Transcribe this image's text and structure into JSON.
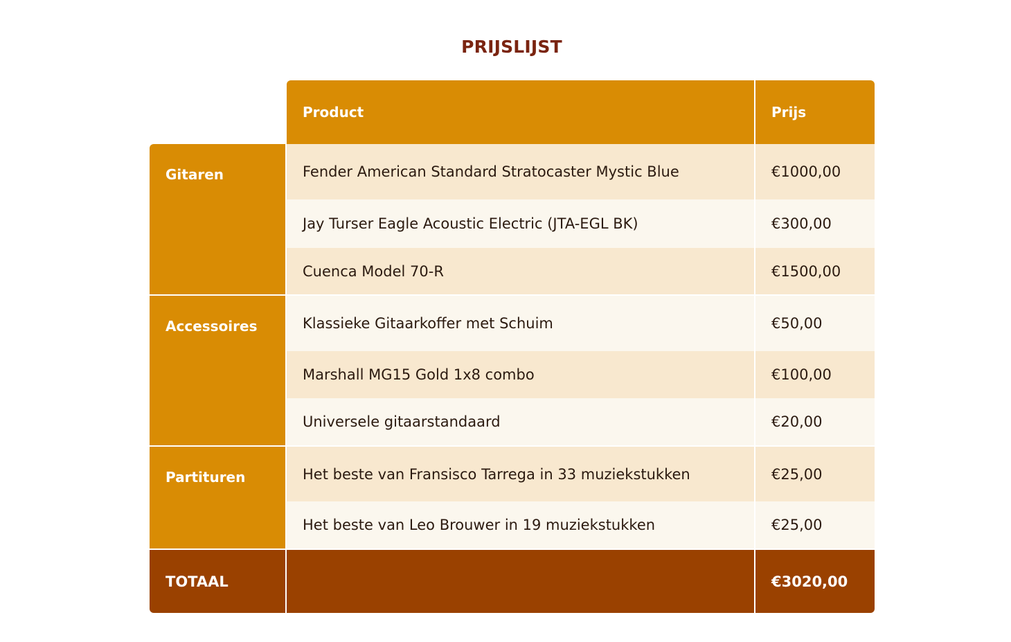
{
  "title": "PRIJSLIJST",
  "header": {
    "product": "Product",
    "price": "Prijs"
  },
  "categories": [
    {
      "label": "Gitaren"
    },
    {
      "label": "Accessoires"
    },
    {
      "label": "Partituren"
    }
  ],
  "rows": [
    {
      "product": "Fender American Standard Stratocaster Mystic Blue",
      "price": "€1000,00"
    },
    {
      "product": "Jay Turser Eagle Acoustic Electric (JTA-EGL BK)",
      "price": "€300,00"
    },
    {
      "product": "Cuenca Model 70-R",
      "price": "€1500,00"
    },
    {
      "product": "Klassieke Gitaarkoffer met Schuim",
      "price": "€50,00"
    },
    {
      "product": "Marshall MG15 Gold 1x8 combo",
      "price": "€100,00"
    },
    {
      "product": "Universele gitaarstandaard",
      "price": "€20,00"
    },
    {
      "product": "Het beste van Fransisco Tarrega in 33 muziekstukken",
      "price": "€25,00"
    },
    {
      "product": "Het beste van Leo Brouwer in 19 muziekstukken",
      "price": "€25,00"
    }
  ],
  "total": {
    "label": "TOTAAL",
    "price": "€3020,00"
  },
  "colors": {
    "title": "#7a2410",
    "header": "#d98c04",
    "row_light": "#fbf7ee",
    "row_tint": "#f8e8cf",
    "total": "#9a4100"
  }
}
